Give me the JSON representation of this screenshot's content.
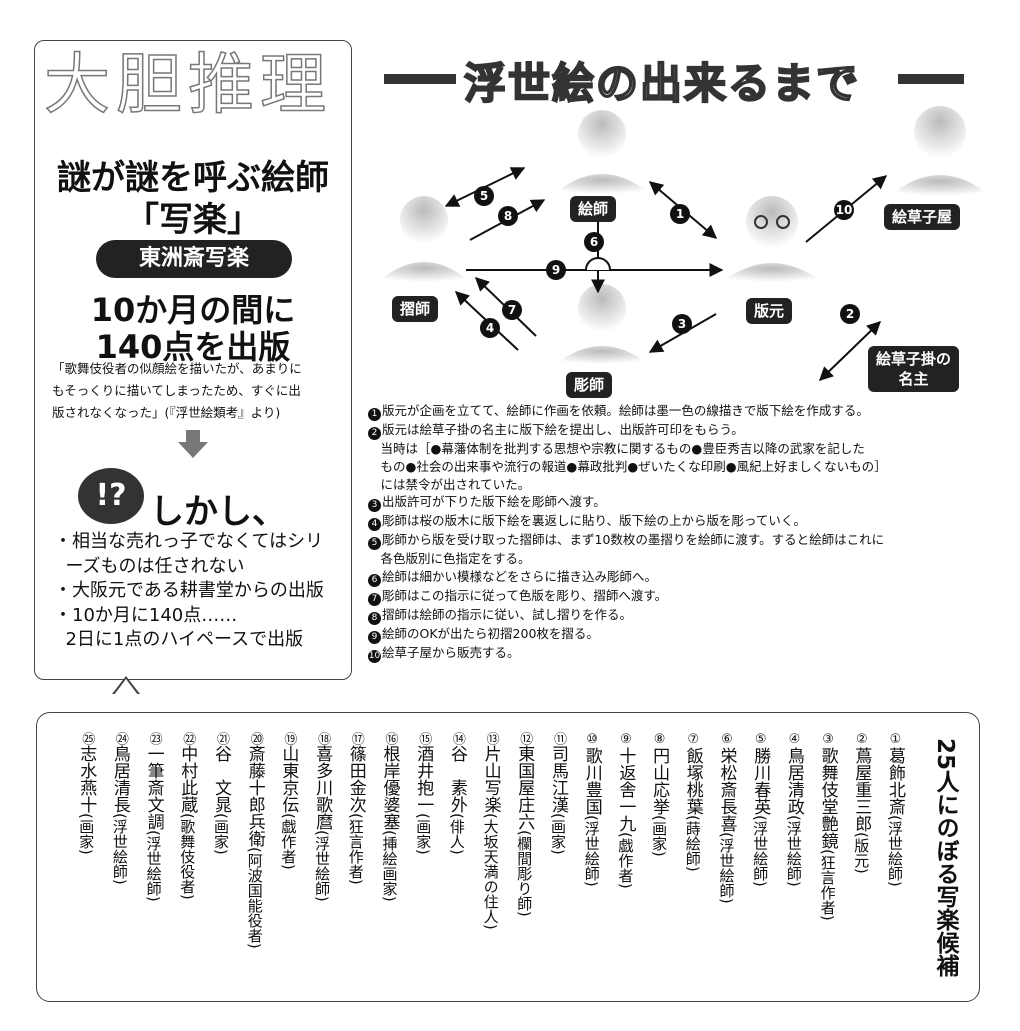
{
  "left": {
    "feature_label": "大胆推理",
    "title_line1": "謎が謎を呼ぶ絵師",
    "title_line2": "「写楽」",
    "name_pill": "東洲斎写楽",
    "stat_line1": "10か月の間に",
    "stat_line2": "140点を出版",
    "quote_lines": [
      "「歌舞伎役者の似顔絵を描いたが、あまりに",
      "もそっくりに描いてしまったため、すぐに出",
      "版されなくなった」(『浮世絵類考』より)"
    ],
    "alert_symbol": "!?",
    "but_text": "しかし、",
    "bullets": [
      "・相当な売れっ子でなくてはシリ",
      "  ーズものは任されない",
      "・大阪元である耕書堂からの出版",
      "・10か月に140点……",
      "  2日に1点のハイペースで出版"
    ]
  },
  "diagram": {
    "title": "浮世絵の出来るまで",
    "people": {
      "eshi": "絵師",
      "surishi": "摺師",
      "horishi": "彫師",
      "hanmoto": "版元",
      "ezoshiya": "絵草子屋",
      "nanushi_line1": "絵草子掛の",
      "nanushi_line2": "名主"
    },
    "arrow_numbers": [
      "1",
      "2",
      "3",
      "4",
      "5",
      "6",
      "7",
      "8",
      "9",
      "10"
    ]
  },
  "steps": [
    {
      "n": "1",
      "text": "版元が企画を立てて、絵師に作画を依頼。絵師は墨一色の線描きで版下絵を作成する。"
    },
    {
      "n": "2",
      "text": "版元は絵草子掛の名主に版下絵を提出し、出版許可印をもらう。"
    },
    {
      "n": "",
      "text": "　当時は［●幕藩体制を批判する思想や宗教に関するもの●豊臣秀吉以降の武家を記した"
    },
    {
      "n": "",
      "text": "　もの●社会の出来事や流行の報道●幕政批判●ぜいたくな印刷●風紀上好ましくないもの］"
    },
    {
      "n": "",
      "text": "　には禁令が出されていた。"
    },
    {
      "n": "3",
      "text": "出版許可が下りた版下絵を彫師へ渡す。"
    },
    {
      "n": "4",
      "text": "彫師は桜の版木に版下絵を裏返しに貼り、版下絵の上から版を彫っていく。"
    },
    {
      "n": "5",
      "text": "彫師から版を受け取った摺師は、まず10数枚の墨摺りを絵師に渡す。すると絵師はこれに"
    },
    {
      "n": "",
      "text": "　各色版別に色指定をする。"
    },
    {
      "n": "6",
      "text": "絵師は細かい模様などをさらに描き込み彫師へ。"
    },
    {
      "n": "7",
      "text": "彫師はこの指示に従って色版を彫り、摺師へ渡す。"
    },
    {
      "n": "8",
      "text": "摺師は絵師の指示に従い、試し摺りを作る。"
    },
    {
      "n": "9",
      "text": "絵師のOKが出たら初摺200枚を摺る。"
    },
    {
      "n": "10",
      "text": "絵草子屋から販売する。"
    }
  ],
  "candidates": {
    "heading": "25人にのぼる写楽候補",
    "items": [
      {
        "n": "①",
        "name": "葛飾北斎",
        "role": "(浮世絵師)"
      },
      {
        "n": "②",
        "name": "蔦屋重三郎",
        "role": "(版元)"
      },
      {
        "n": "③",
        "name": "歌舞伎堂艶鏡",
        "role": "(狂言作者)"
      },
      {
        "n": "④",
        "name": "鳥居清政",
        "role": "(浮世絵師)"
      },
      {
        "n": "⑤",
        "name": "勝川春英",
        "role": "(浮世絵師)"
      },
      {
        "n": "⑥",
        "name": "栄松斎長喜",
        "role": "(浮世絵師)"
      },
      {
        "n": "⑦",
        "name": "飯塚桃葉",
        "role": "(蒔絵師)"
      },
      {
        "n": "⑧",
        "name": "円山応挙",
        "role": "(画家)"
      },
      {
        "n": "⑨",
        "name": "十返舎一九",
        "role": "(戯作者)"
      },
      {
        "n": "⑩",
        "name": "歌川豊国",
        "role": "(浮世絵師)"
      },
      {
        "n": "⑪",
        "name": "司馬江漢",
        "role": "(画家)"
      },
      {
        "n": "⑫",
        "name": "東国屋庄六",
        "role": "(欄間彫り師)"
      },
      {
        "n": "⑬",
        "name": "片山写楽",
        "role": "(大坂天満の住人)"
      },
      {
        "n": "⑭",
        "name": "谷　素外",
        "role": "(俳人)"
      },
      {
        "n": "⑮",
        "name": "酒井抱一",
        "role": "(画家)"
      },
      {
        "n": "⑯",
        "name": "根岸優婆塞",
        "role": "(挿絵画家)"
      },
      {
        "n": "⑰",
        "name": "篠田金次",
        "role": "(狂言作者)"
      },
      {
        "n": "⑱",
        "name": "喜多川歌麿",
        "role": "(浮世絵師)"
      },
      {
        "n": "⑲",
        "name": "山東京伝",
        "role": "(戯作者)"
      },
      {
        "n": "⑳",
        "name": "斎藤十郎兵衛",
        "role": "(阿波国能役者)"
      },
      {
        "n": "㉑",
        "name": "谷　文晁",
        "role": "(画家)"
      },
      {
        "n": "㉒",
        "name": "中村此蔵",
        "role": "(歌舞伎役者)"
      },
      {
        "n": "㉓",
        "name": "一筆斎文調",
        "role": "(浮世絵師)"
      },
      {
        "n": "㉔",
        "name": "鳥居清長",
        "role": "(浮世絵師)"
      },
      {
        "n": "㉕",
        "name": "志水燕十",
        "role": "(画家)"
      }
    ]
  }
}
